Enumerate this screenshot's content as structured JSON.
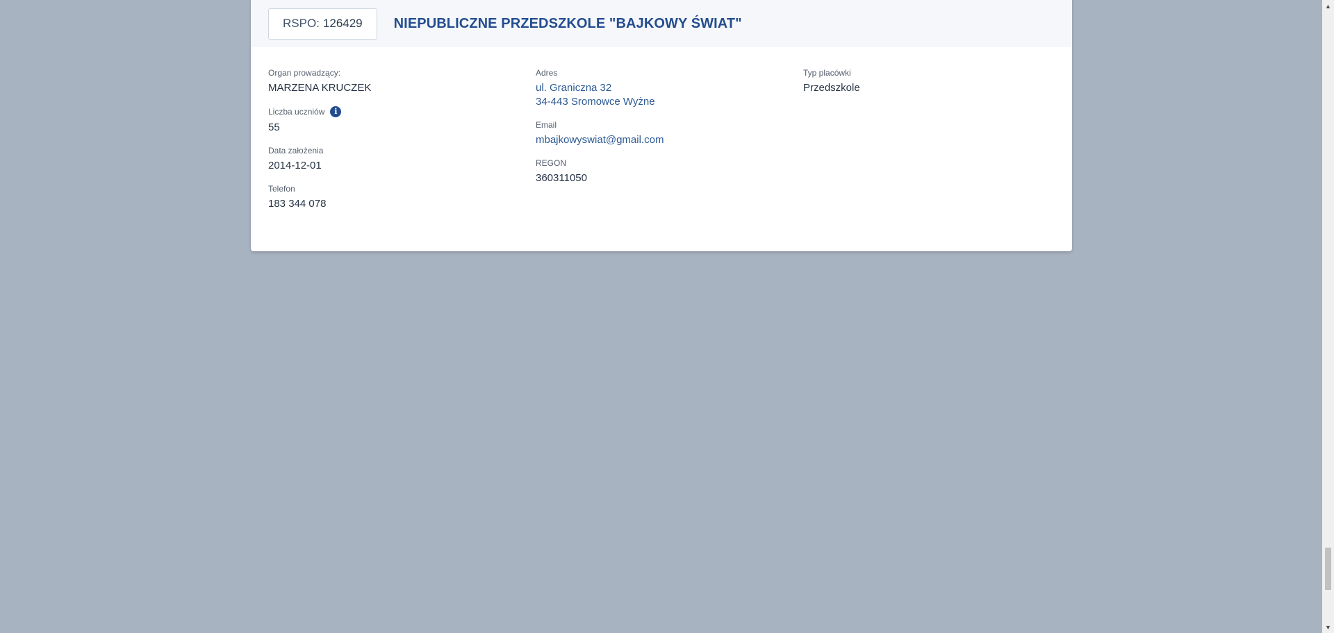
{
  "header": {
    "rspo_prefix": "RSPO:",
    "rspo_number": "126429",
    "school_name": "NIEPUBLICZNE PRZEDSZKOLE \"BAJKOWY ŚWIAT\""
  },
  "details": {
    "organ_label": "Organ prowadzący:",
    "organ_value": "MARZENA KRUCZEK",
    "students_label": "Liczba uczniów",
    "students_info_icon": "info-icon",
    "students_value": "55",
    "founded_label": "Data założenia",
    "founded_value": "2014-12-01",
    "phone_label": "Telefon",
    "phone_value": "183 344 078",
    "address_label": "Adres",
    "address_line1": "ul. Graniczna 32",
    "address_line2": "34-443 Sromowce Wyżne",
    "email_label": "Email",
    "email_value": "mbajkowyswiat@gmail.com",
    "regon_label": "REGON",
    "regon_value": "360311050",
    "type_label": "Typ placówki",
    "type_value": "Przedszkole"
  },
  "colors": {
    "background": "#a8b3c1",
    "accent": "#234d8e",
    "link": "#2d5a94"
  }
}
